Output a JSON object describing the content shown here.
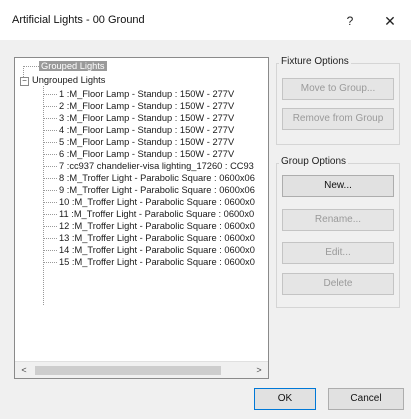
{
  "window": {
    "title": "Artificial Lights - 00 Ground",
    "help_label": "?",
    "close_label": "✕"
  },
  "tree": {
    "expander_symbol": "−",
    "grouped_label": "Grouped Lights",
    "ungrouped_label": "Ungrouped Lights",
    "items": [
      "1 :M_Floor Lamp - Standup : 150W - 277V",
      "2 :M_Floor Lamp - Standup : 150W - 277V",
      "3 :M_Floor Lamp - Standup : 150W - 277V",
      "4 :M_Floor Lamp - Standup : 150W - 277V",
      "5 :M_Floor Lamp - Standup : 150W - 277V",
      "6 :M_Floor Lamp - Standup : 150W - 277V",
      "7 :cc937 chandelier-visa lighting_17260 : CC93",
      "8 :M_Troffer Light - Parabolic Square : 0600x06",
      "9 :M_Troffer Light - Parabolic Square : 0600x06",
      "10 :M_Troffer Light - Parabolic Square : 0600x0",
      "11 :M_Troffer Light - Parabolic Square : 0600x0",
      "12 :M_Troffer Light - Parabolic Square : 0600x0",
      "13 :M_Troffer Light - Parabolic Square : 0600x0",
      "14 :M_Troffer Light - Parabolic Square : 0600x0",
      "15 :M_Troffer Light - Parabolic Square : 0600x0"
    ],
    "scroll_left": "<",
    "scroll_right": ">"
  },
  "fixture_options": {
    "legend": "Fixture Options",
    "move_to_group": "Move to Group...",
    "remove_from_group": "Remove from Group"
  },
  "group_options": {
    "legend": "Group Options",
    "new": "New...",
    "rename": "Rename...",
    "edit": "Edit...",
    "delete": "Delete"
  },
  "footer": {
    "ok": "OK",
    "cancel": "Cancel"
  },
  "colors": {
    "selection": "#9a9a9a",
    "dialog_bg": "#f0f0f0",
    "primary_border": "#0078d7"
  }
}
